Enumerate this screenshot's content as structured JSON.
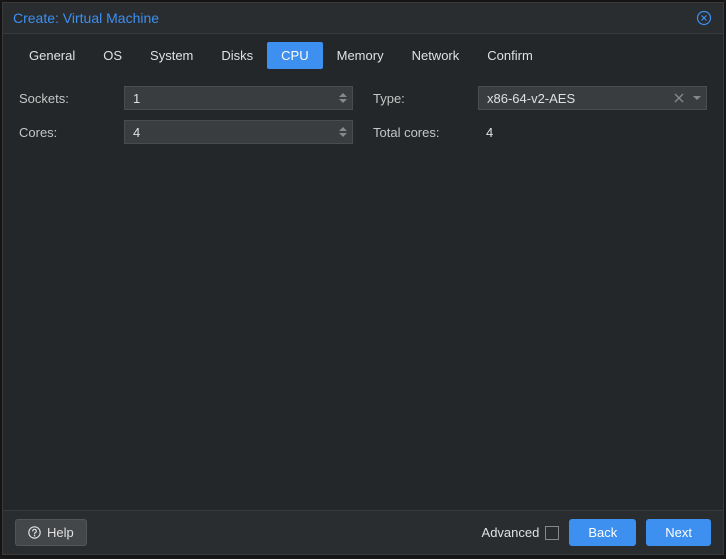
{
  "dialog": {
    "title": "Create: Virtual Machine"
  },
  "tabs": [
    {
      "label": "General"
    },
    {
      "label": "OS"
    },
    {
      "label": "System"
    },
    {
      "label": "Disks"
    },
    {
      "label": "CPU"
    },
    {
      "label": "Memory"
    },
    {
      "label": "Network"
    },
    {
      "label": "Confirm"
    }
  ],
  "activeTabIndex": 4,
  "form": {
    "sockets": {
      "label": "Sockets:",
      "value": "1"
    },
    "cores": {
      "label": "Cores:",
      "value": "4"
    },
    "type": {
      "label": "Type:",
      "value": "x86-64-v2-AES"
    },
    "total": {
      "label": "Total cores:",
      "value": "4"
    }
  },
  "footer": {
    "help": "Help",
    "advanced": "Advanced",
    "advancedChecked": false,
    "back": "Back",
    "next": "Next"
  }
}
